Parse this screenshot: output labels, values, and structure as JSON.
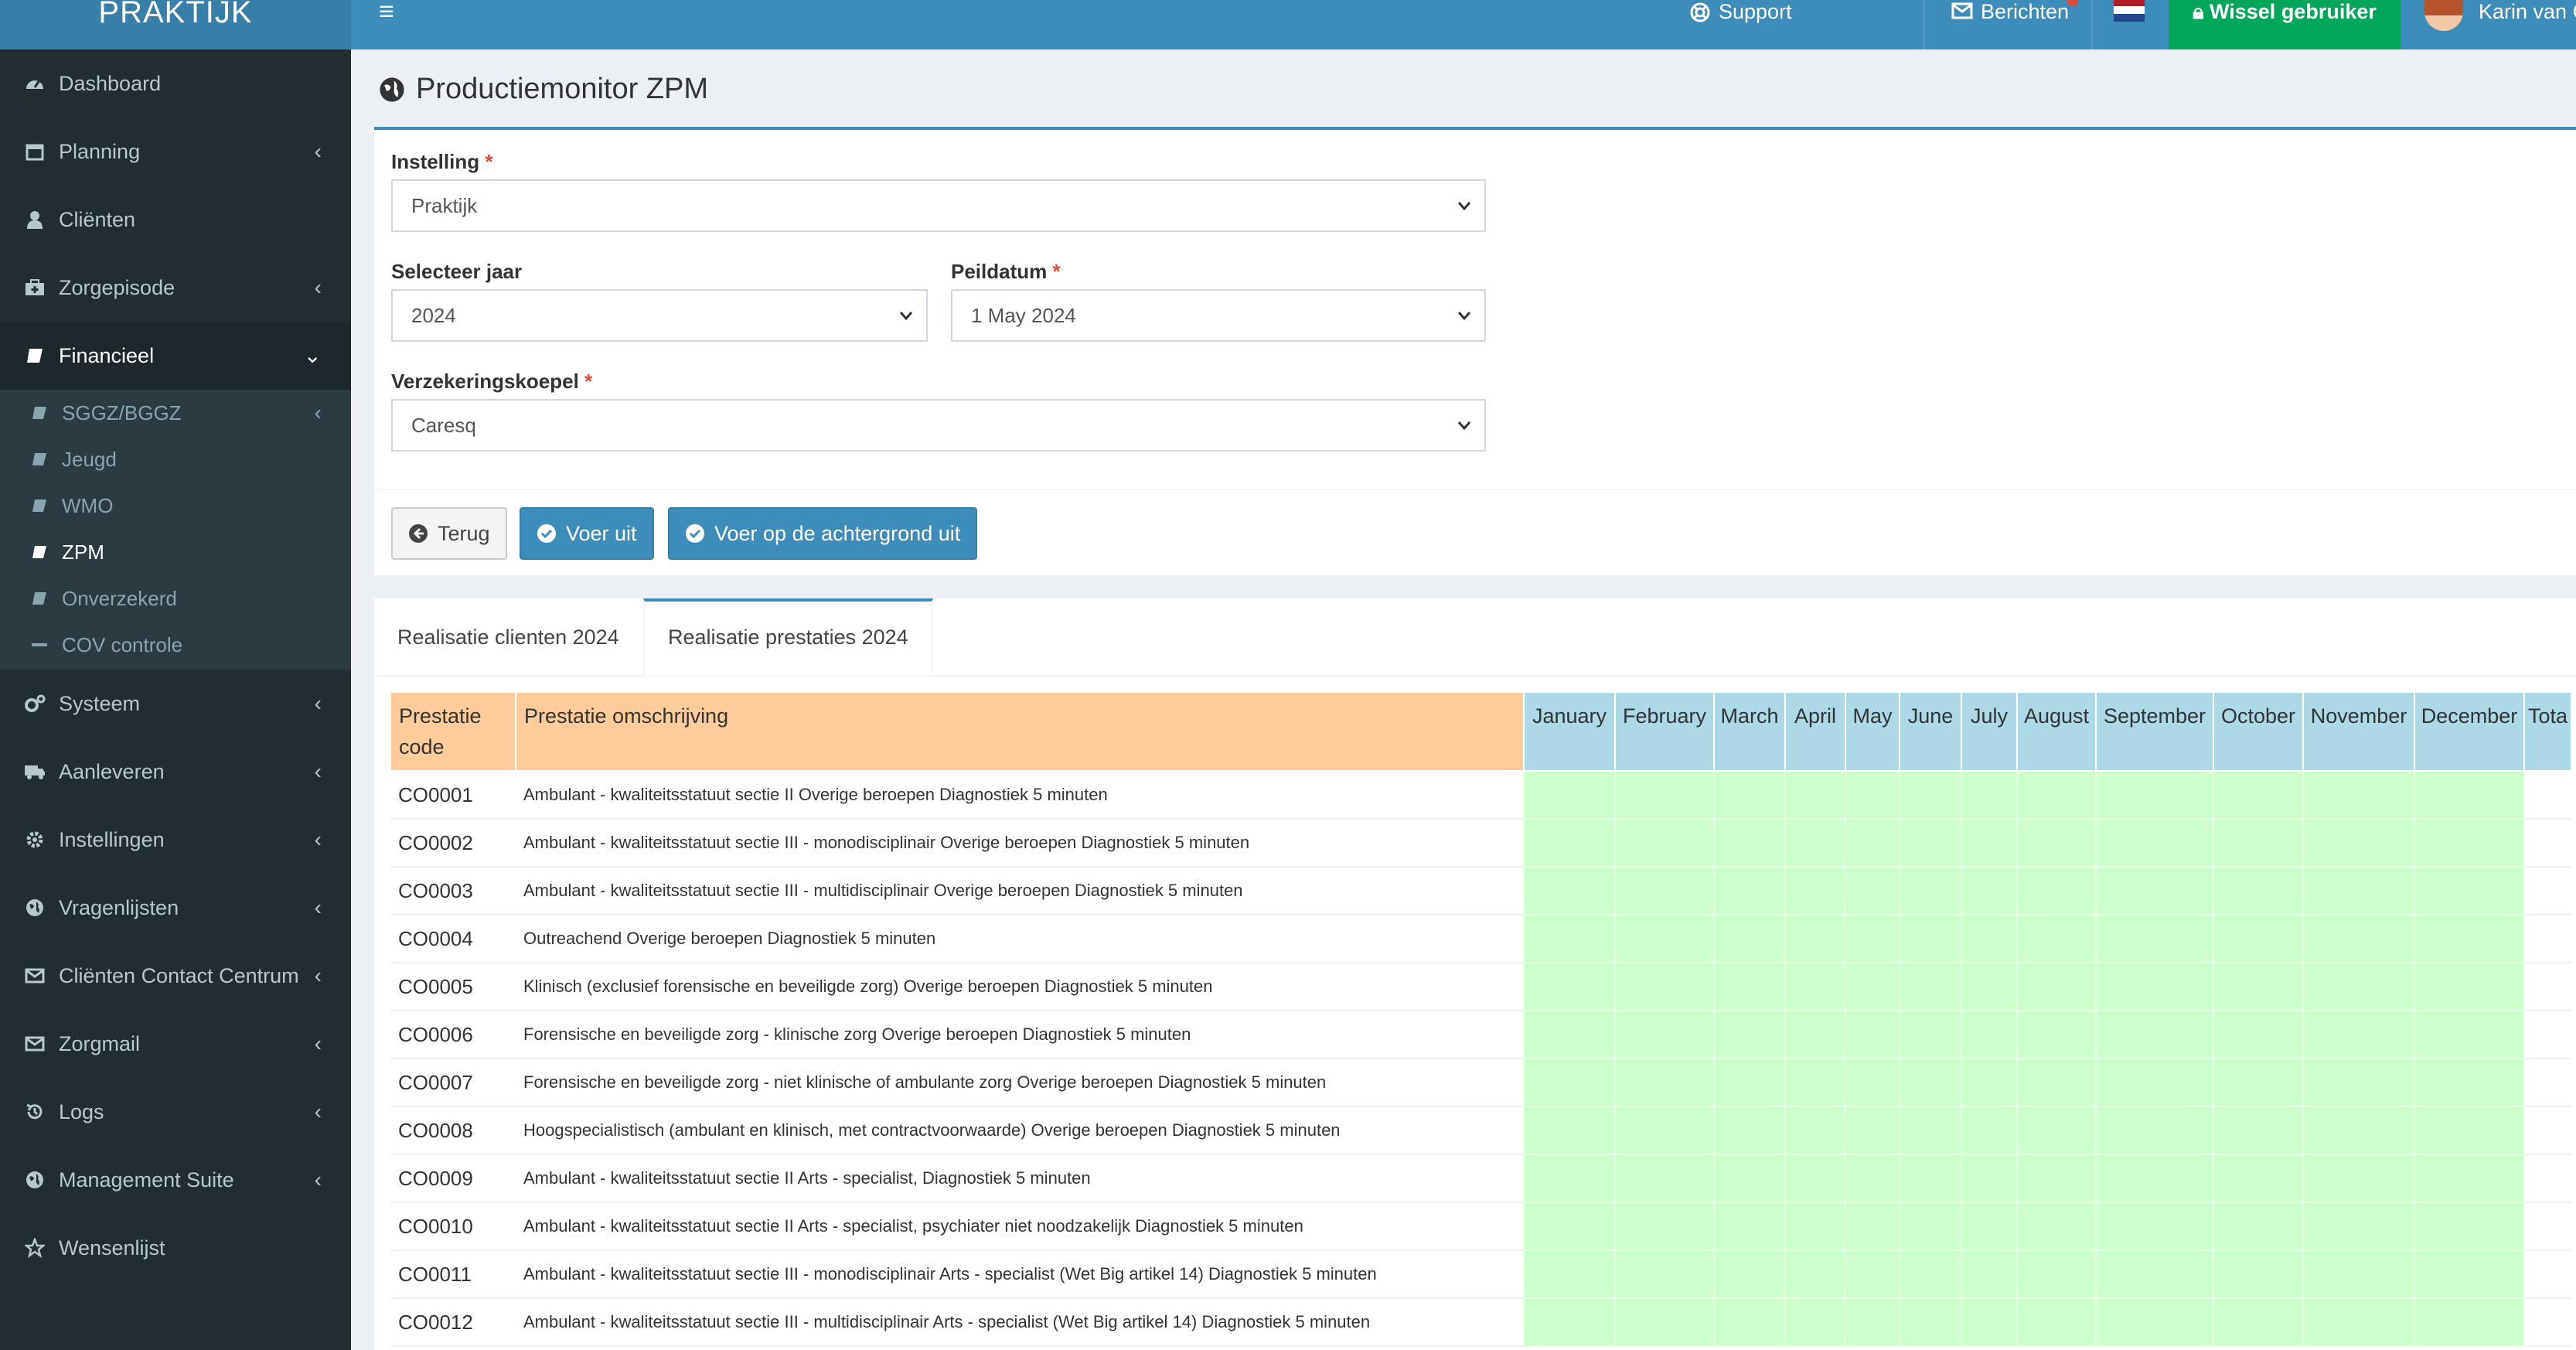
{
  "topbar": {
    "logo": "PRAKTIJK",
    "support_label": "Support",
    "berichten_label": "Berichten",
    "wissel_label": "Wissel gebruiker",
    "user_name": "Karin van G"
  },
  "sidebar": {
    "items": [
      {
        "label": "Dashboard",
        "icon": "dashboard-icon"
      },
      {
        "label": "Planning",
        "icon": "calendar-icon"
      },
      {
        "label": "Cliënten",
        "icon": "user-icon"
      },
      {
        "label": "Zorgepisode",
        "icon": "medkit-icon"
      },
      {
        "label": "Financieel",
        "icon": "book-icon"
      },
      {
        "label": "Systeem",
        "icon": "cogs-icon"
      },
      {
        "label": "Aanleveren",
        "icon": "truck-icon"
      },
      {
        "label": "Instellingen",
        "icon": "gear-icon"
      },
      {
        "label": "Vragenlijsten",
        "icon": "globe-icon"
      },
      {
        "label": "Cliënten Contact Centrum",
        "icon": "envelope-icon"
      },
      {
        "label": "Zorgmail",
        "icon": "envelope-icon"
      },
      {
        "label": "Logs",
        "icon": "history-icon"
      },
      {
        "label": "Management Suite",
        "icon": "globe-icon"
      },
      {
        "label": "Wensenlijst",
        "icon": "star-icon"
      }
    ],
    "subitems": [
      {
        "label": "SGGZ/BGGZ"
      },
      {
        "label": "Jeugd"
      },
      {
        "label": "WMO"
      },
      {
        "label": "ZPM"
      },
      {
        "label": "Onverzekerd"
      },
      {
        "label": "COV controle"
      }
    ]
  },
  "page": {
    "title": "Productiemonitor ZPM"
  },
  "form": {
    "instelling_label": "Instelling",
    "instelling_value": "Praktijk",
    "jaar_label": "Selecteer jaar",
    "jaar_value": "2024",
    "peildatum_label": "Peildatum",
    "peildatum_value": "1 May 2024",
    "koepel_label": "Verzekeringskoepel",
    "koepel_value": "Caresq",
    "required_mark": "*"
  },
  "buttons": {
    "terug": "Terug",
    "voer_uit": "Voer uit",
    "voer_achtergrond": "Voer op de achtergrond uit"
  },
  "tabs": {
    "clienten": "Realisatie clienten 2024",
    "prestaties": "Realisatie prestaties 2024"
  },
  "table": {
    "code_header": "Prestatie code",
    "desc_header": "Prestatie omschrijving",
    "months": [
      "January",
      "February",
      "March",
      "April",
      "May",
      "June",
      "July",
      "August",
      "September",
      "October",
      "November",
      "December"
    ],
    "total_header": "Tota",
    "rows": [
      {
        "code": "CO0001",
        "desc": "Ambulant - kwaliteitsstatuut sectie II Overige beroepen Diagnostiek 5 minuten"
      },
      {
        "code": "CO0002",
        "desc": "Ambulant - kwaliteitsstatuut sectie III - monodisciplinair Overige beroepen Diagnostiek 5 minuten"
      },
      {
        "code": "CO0003",
        "desc": "Ambulant - kwaliteitsstatuut sectie III - multidisciplinair Overige beroepen Diagnostiek 5 minuten"
      },
      {
        "code": "CO0004",
        "desc": "Outreachend Overige beroepen Diagnostiek 5 minuten"
      },
      {
        "code": "CO0005",
        "desc": "Klinisch (exclusief forensische en beveiligde zorg) Overige beroepen Diagnostiek 5 minuten"
      },
      {
        "code": "CO0006",
        "desc": "Forensische en beveiligde zorg - klinische zorg Overige beroepen Diagnostiek 5 minuten"
      },
      {
        "code": "CO0007",
        "desc": "Forensische en beveiligde zorg - niet klinische of ambulante zorg Overige beroepen Diagnostiek 5 minuten"
      },
      {
        "code": "CO0008",
        "desc": "Hoogspecialistisch (ambulant en klinisch, met contractvoorwaarde) Overige beroepen Diagnostiek 5 minuten"
      },
      {
        "code": "CO0009",
        "desc": "Ambulant - kwaliteitsstatuut sectie II Arts - specialist, Diagnostiek 5 minuten"
      },
      {
        "code": "CO0010",
        "desc": "Ambulant - kwaliteitsstatuut sectie II Arts - specialist, psychiater niet noodzakelijk Diagnostiek 5 minuten"
      },
      {
        "code": "CO0011",
        "desc": "Ambulant - kwaliteitsstatuut sectie III - monodisciplinair Arts - specialist (Wet Big artikel 14) Diagnostiek 5 minuten"
      },
      {
        "code": "CO0012",
        "desc": "Ambulant - kwaliteitsstatuut sectie III - multidisciplinair Arts - specialist (Wet Big artikel 14) Diagnostiek 5 minuten"
      }
    ]
  },
  "colors": {
    "topbar": "#3c8dbc",
    "sidebar": "#222d32",
    "green_button": "#00a65a",
    "header_orange": "#ffcc99",
    "header_blue": "#add8e6",
    "cell_green": "#ccffcc"
  }
}
